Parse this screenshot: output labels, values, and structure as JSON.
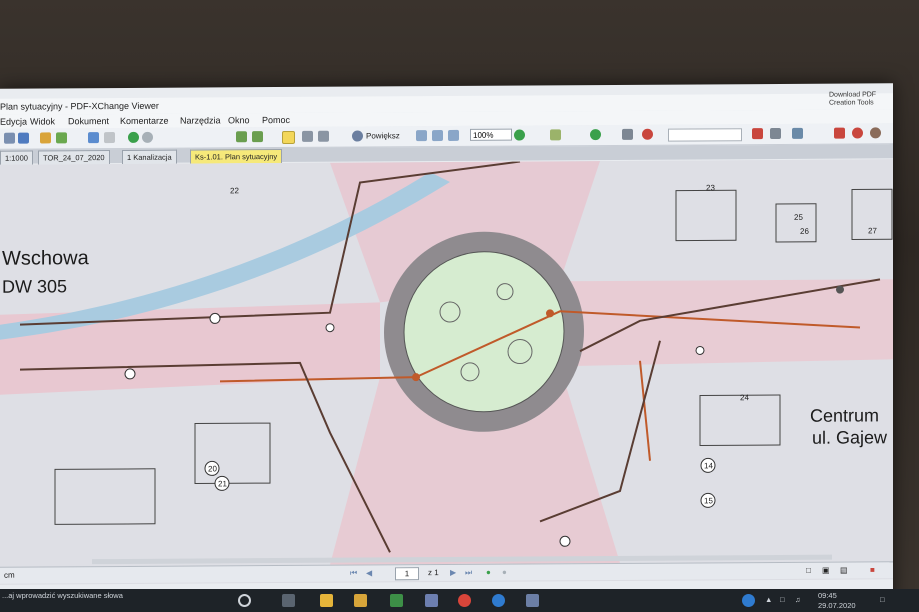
{
  "window": {
    "title": "Plan sytuacyjny - PDF-XChange Viewer",
    "download_promo": "Download PDF Creation Tools"
  },
  "menu": [
    "Edycja",
    "Widok",
    "Dokument",
    "Komentarze",
    "Narzędzia",
    "Okno",
    "Pomoc"
  ],
  "toolbar": {
    "zoom_label": "Powiększ",
    "zoom_value": "100%"
  },
  "tabs": [
    {
      "label": "1:1000"
    },
    {
      "label": "TOR_24_07_2020"
    },
    {
      "label": "1 Kanalizacja"
    },
    {
      "label": "Ks-1.01. Plan sytuacyjny",
      "active": true
    }
  ],
  "map": {
    "labels": {
      "wschowa": "Wschowa",
      "dw305": "DW 305",
      "centrum": "Centrum",
      "gajew": "ul. Gajew"
    },
    "numbers": [
      "14",
      "15",
      "20",
      "21",
      "22",
      "23",
      "24",
      "25",
      "26",
      "27"
    ]
  },
  "status": {
    "units": "cm",
    "page_current": "1",
    "page_total": "z 1"
  },
  "taskbar": {
    "search_text": "...aj wprowadzić wyszukiwane słowa",
    "time": "09:45",
    "date": "29.07.2020"
  },
  "colors": {
    "accent_tab": "#f6e97a",
    "roundabout_ring": "#8e8a8d",
    "center_green": "#d7ecd0",
    "road_pink": "#e6c6cf",
    "sewer_line": "#c05a2a",
    "water_blue": "#9fc4dc"
  }
}
